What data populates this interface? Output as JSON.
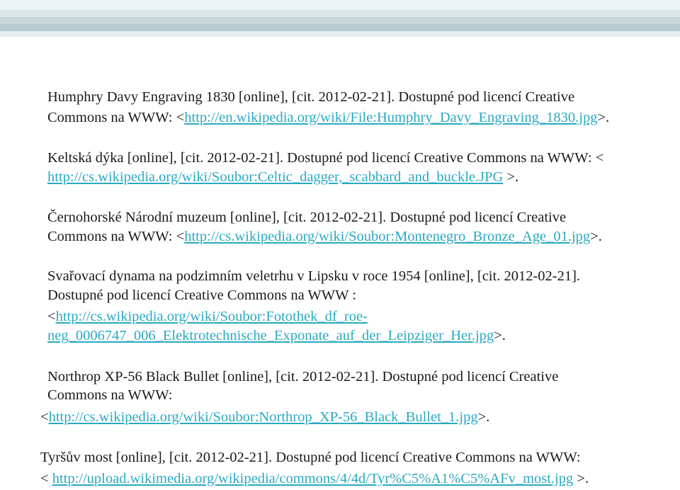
{
  "refs": [
    {
      "l1": "Humphry Davy Engraving 1830 [online], [cit. 2012-02-21]. Dostupné pod licencí Creative",
      "l2_pre": "Commons na WWW: <",
      "l2_link": "http://en.wikipedia.org/wiki/File:Humphry_Davy_Engraving_1830.jpg",
      "l2_post": ">."
    },
    {
      "l1": "Keltská dýka [online], [cit. 2012-02-21]. Dostupné pod licencí Creative Commons na WWW: <",
      "l2_link": "http://cs.wikipedia.org/wiki/Soubor:Celtic_dagger,_scabbard_and_buckle.JPG",
      "l2_post": " >."
    },
    {
      "l1": "Černohorské Národní muzeum [online], [cit. 2012-02-21]. Dostupné pod licencí Creative",
      "l2_pre": "Commons na WWW: <",
      "l2_link": "http://cs.wikipedia.org/wiki/Soubor:Montenegro_Bronze_Age_01.jpg",
      "l2_post": ">."
    },
    {
      "l1": "Svařovací dynama na podzimním veletrhu v Lipsku v roce 1954 [online], [cit. 2012-02-21].",
      "l2": "Dostupné pod licencí Creative Commons na WWW :",
      "l3_pre": "<",
      "l3_link": "http://cs.wikipedia.org/wiki/Soubor:Fotothek_df_roe-",
      "l4_link": "neg_0006747_006_Elektrotechnische_Exponate_auf_der_Leipziger_Her.jpg",
      "l4_post": ">."
    },
    {
      "l1": "Northrop XP-56 Black Bullet [online], [cit. 2012-02-21]. Dostupné pod licencí Creative",
      "l2": "Commons na WWW:",
      "l3_pre": "<",
      "l3_link": "http://cs.wikipedia.org/wiki/Soubor:Northrop_XP-56_Black_Bullet_1.jpg",
      "l3_post": ">."
    },
    {
      "l1": "Tyršův most [online], [cit. 2012-02-21]. Dostupné pod licencí Creative Commons na WWW:",
      "l2_pre": "< ",
      "l2_link": "http://upload.wikimedia.org/wikipedia/commons/4/4d/Tyr%C5%A1%C5%AFv_most.jpg",
      "l2_post": " >."
    }
  ]
}
